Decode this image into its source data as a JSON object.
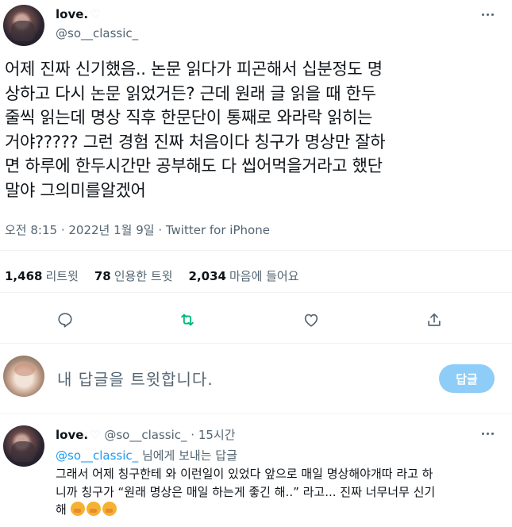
{
  "tweet": {
    "author": {
      "name": "love.",
      "handle": "@so__classic_"
    },
    "text_lines": [
      "어제 진짜 신기했음.. 논문 읽다가 피곤해서 십분정도 명",
      "상하고 다시 논문 읽었거든? 근데 원래 글 읽을 때 한두",
      "줄씩 읽는데 명상 직후 한문단이 통째로 와라락 읽히는",
      "거야????? 그런 경험 진짜 처음이다 칭구가 명상만 잘하",
      "면 하루에 한두시간만 공부해도 다 씹어먹을거라고 했단",
      "말야 그의미를알겠어"
    ],
    "meta": "오전 8:15 · 2022년 1월 9일 · Twitter for iPhone",
    "stats": {
      "retweets": {
        "count": "1,468",
        "label": "리트윗"
      },
      "quotes": {
        "count": "78",
        "label": "인용한 트윗"
      },
      "likes": {
        "count": "2,034",
        "label": "마음에 들어요"
      }
    }
  },
  "compose": {
    "placeholder": "내 답글을 트윗합니다.",
    "button_label": "답글"
  },
  "reply": {
    "author": {
      "name": "love.",
      "handle": "@so__classic_",
      "time": "· 15시간"
    },
    "replying_to": {
      "mention": "@so__classic_",
      "suffix": "님에게 보내는 답글"
    },
    "text_lines": [
      "그래서 어제 칭구한테 와 이런일이 있었다 앞으로 매일 명상해야개따 라고 하",
      "니까 칭구가 “원래 명상은 매일 하는게 좋긴 해..” 라고... 진짜 너무너무 신기",
      "해"
    ]
  },
  "icons": {
    "reply": "speech-bubble-icon",
    "retweet": "retweet-icon",
    "like": "heart-outline-icon",
    "share": "share-icon",
    "more": "more-dots-icon",
    "emoji": "hand-over-mouth-emoji"
  },
  "colors": {
    "accent": "#1d9bf0",
    "retweet_green": "#00ba7c",
    "reply_button_disabled": "#8ecdf8",
    "muted_text": "#536471"
  }
}
